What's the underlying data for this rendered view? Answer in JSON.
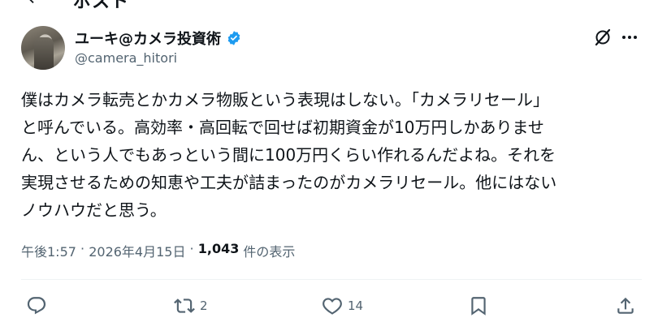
{
  "header": {
    "title": "ポスト"
  },
  "author": {
    "display_name": "ユーキ@カメラ投資術",
    "handle": "@camera_hitori",
    "verified": true
  },
  "post": {
    "text": "僕はカメラ転売とかカメラ物販という表現はしない。「カメラリセール」\nと呼んでいる。高効率・高回転で回せば初期資金が10万円しかありませ\nん、という人でもあっという間に100万円くらい作れるんだよね。それを\n実現させるための知恵や工夫が詰まったのがカメラリセール。他にはない\nノウハウだと思う。",
    "time": "午後1:57",
    "separator1": " · ",
    "date": "2026年4月15日",
    "separator2": " · ",
    "views_count": "1,043",
    "views_label": " 件の表示"
  },
  "actions": {
    "reply_count": "",
    "repost_count": "2",
    "like_count": "14"
  },
  "colors": {
    "verified_blue": "#1d9bf0",
    "muted": "#536471",
    "text": "#0f1419"
  }
}
